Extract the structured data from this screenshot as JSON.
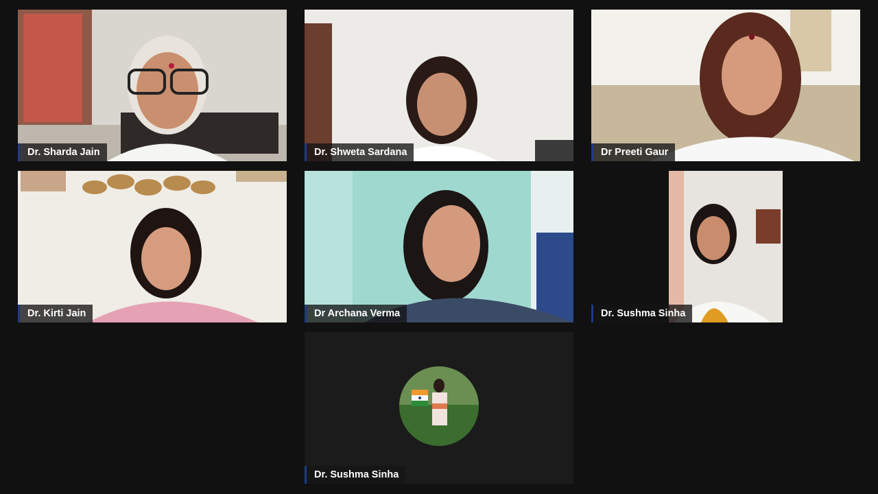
{
  "meeting": {
    "participants": [
      {
        "name": "Dr. Sharda Jain"
      },
      {
        "name": "Dr. Shweta Sardana"
      },
      {
        "name": "Dr Preeti Gaur"
      },
      {
        "name": "Dr. Kirti Jain"
      },
      {
        "name": "Dr Archana Verma"
      },
      {
        "name": "Dr. Sushma Sinha"
      },
      {
        "name": "Dr. Sushma Sinha"
      }
    ]
  },
  "colors": {
    "background": "#111111",
    "name_tag_accent": "#1e3a8a",
    "name_tag_bg": "#141414"
  },
  "icons": {
    "profile_avatar": "avatar-with-indian-flag"
  }
}
